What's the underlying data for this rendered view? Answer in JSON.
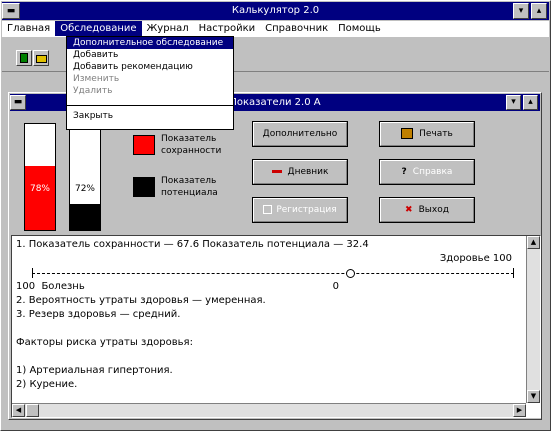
{
  "window": {
    "title": "Калькулятор 2.0",
    "min_glyph": "▾",
    "max_glyph": "▴",
    "sys_glyph": "▬"
  },
  "menubar": {
    "items": [
      "Главная",
      "Обследование",
      "Журнал",
      "Настройки",
      "Справочник",
      "Помощь"
    ],
    "active_index": 1
  },
  "dropdown": {
    "items": [
      {
        "label": "Дополнительное обследование",
        "enabled": true
      },
      {
        "label": "Добавить",
        "enabled": true
      },
      {
        "label": "Добавить рекомендацию",
        "enabled": true
      },
      {
        "label": "Изменить",
        "enabled": false
      },
      {
        "label": "Удалить",
        "enabled": false
      },
      {
        "label": "Закрыть",
        "enabled": true
      }
    ]
  },
  "child_window": {
    "title": "Показатели 2.0 А",
    "min_glyph": "▾",
    "max_glyph": "▴",
    "sys_glyph": "▬"
  },
  "gauges": [
    {
      "value_label": "78%",
      "fill_fraction": 0.6,
      "color": "#ff0000"
    },
    {
      "value_label": "72%",
      "fill_fraction": 0.25,
      "color": "#000000"
    }
  ],
  "legend": [
    {
      "label": "Показатель сохранности",
      "color": "#ff0000"
    },
    {
      "label": "Показатель потенциала",
      "color": "#000000"
    }
  ],
  "buttons": {
    "dop": {
      "label": "Дополнительно"
    },
    "dnevnik": {
      "label": "Дневник",
      "icon_color": "#cc0000"
    },
    "reg": {
      "label": "Регистрация"
    },
    "print": {
      "label": "Печать",
      "icon_color": "#c08000"
    },
    "spravka": {
      "label": "Справка"
    },
    "exit": {
      "label": "Выход",
      "icon_color": "#cc0000"
    }
  },
  "results": {
    "lines": [
      "1. Показатель сохранности — 67.6  Показатель потенциала — 32.4",
      "Здоровье 100",
      "",
      "100  Болезнь                                                                              0",
      "2. Вероятность утраты здоровья — умеренная.",
      "3. Резерв здоровья — средний.",
      "",
      "Факторы риска утраты здоровья:",
      "",
      "1) Артериальная гипертония.",
      "2) Курение."
    ]
  }
}
